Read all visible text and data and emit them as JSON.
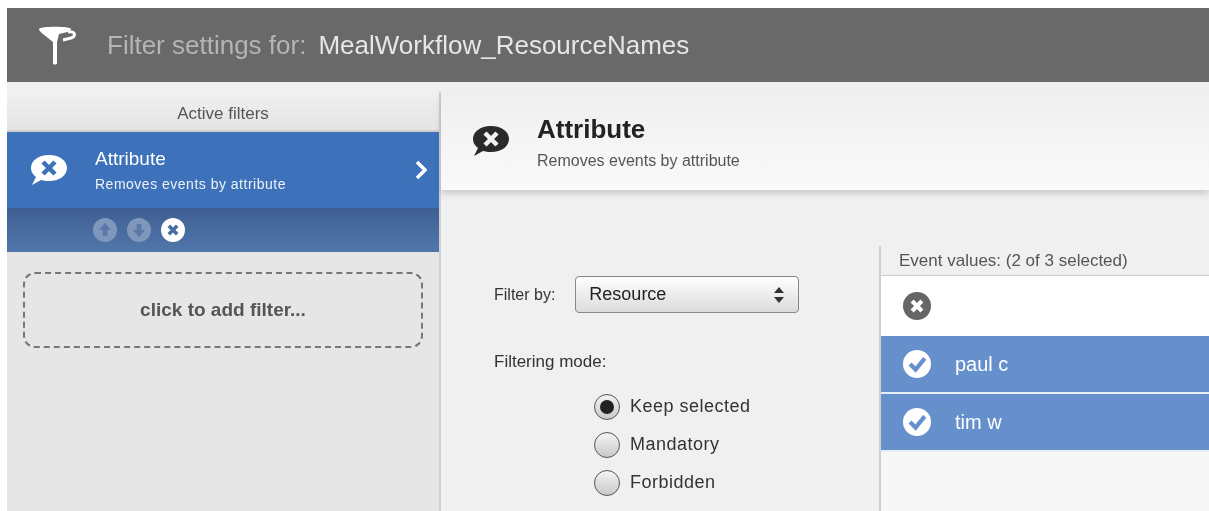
{
  "header": {
    "prefix": "Filter settings for:",
    "name": "MealWorkflow_ResourceNames"
  },
  "sidebar": {
    "title": "Active filters",
    "filters": [
      {
        "title": "Attribute",
        "subtitle": "Removes events by attribute",
        "selected": true
      }
    ],
    "add_label": "click to add filter..."
  },
  "detail": {
    "title": "Attribute",
    "subtitle": "Removes events by attribute",
    "filter_by_label": "Filter by:",
    "filter_by_value": "Resource",
    "mode_label": "Filtering mode:",
    "modes": [
      {
        "label": "Keep selected",
        "selected": true
      },
      {
        "label": "Mandatory",
        "selected": false
      },
      {
        "label": "Forbidden",
        "selected": false
      }
    ],
    "values_title": "Event values:  (2 of 3 selected)",
    "values": [
      {
        "kind": "clear"
      },
      {
        "kind": "value",
        "label": "paul c",
        "selected": true
      },
      {
        "kind": "value",
        "label": "tim w",
        "selected": true
      }
    ]
  }
}
